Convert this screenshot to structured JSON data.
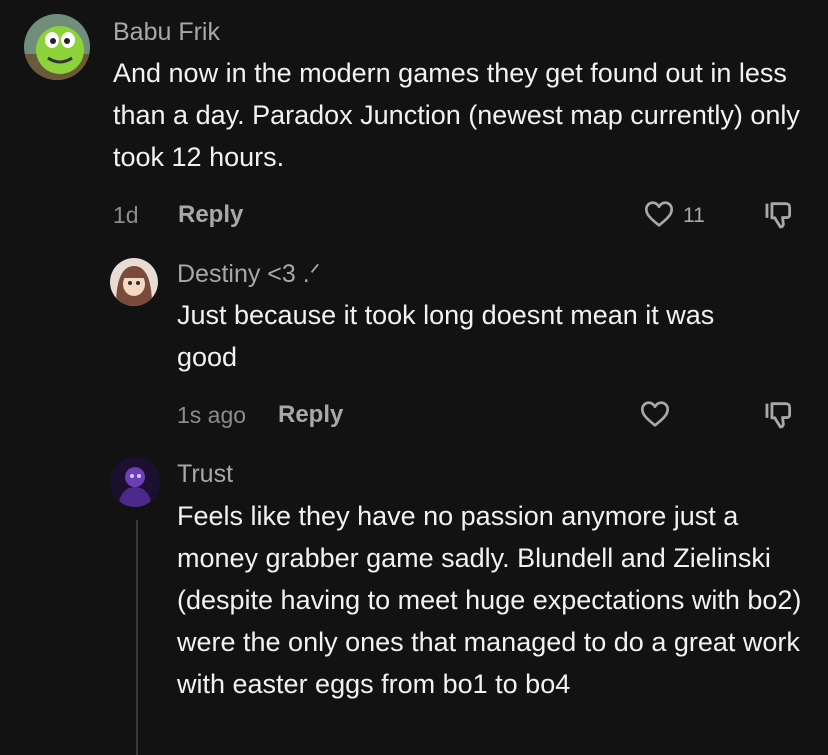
{
  "comments": [
    {
      "author": "Babu Frik",
      "text": "And now in the modern games they get found out in less than a day. Paradox Junction (newest map currently) only took 12 hours.",
      "time": "1d",
      "reply_label": "Reply",
      "like_count": "11"
    },
    {
      "author": "Destiny <3 .ᐟ",
      "text": "Just because it took long doesnt mean it was good",
      "time": "1s ago",
      "reply_label": "Reply"
    },
    {
      "author": "Trust",
      "text": "Feels like they have no passion anymore just a money grabber game sadly. Blundell and Zielinski (despite having to meet huge expectations with bo2) were the only ones that managed to do a great work with easter eggs from bo1 to bo4"
    }
  ],
  "icons": {
    "like": "heart-outline-icon",
    "dislike": "thumbs-down-outline-icon"
  },
  "colors": {
    "background": "#121212",
    "text": "#f2f2f2",
    "secondary": "#a8a8a8"
  }
}
